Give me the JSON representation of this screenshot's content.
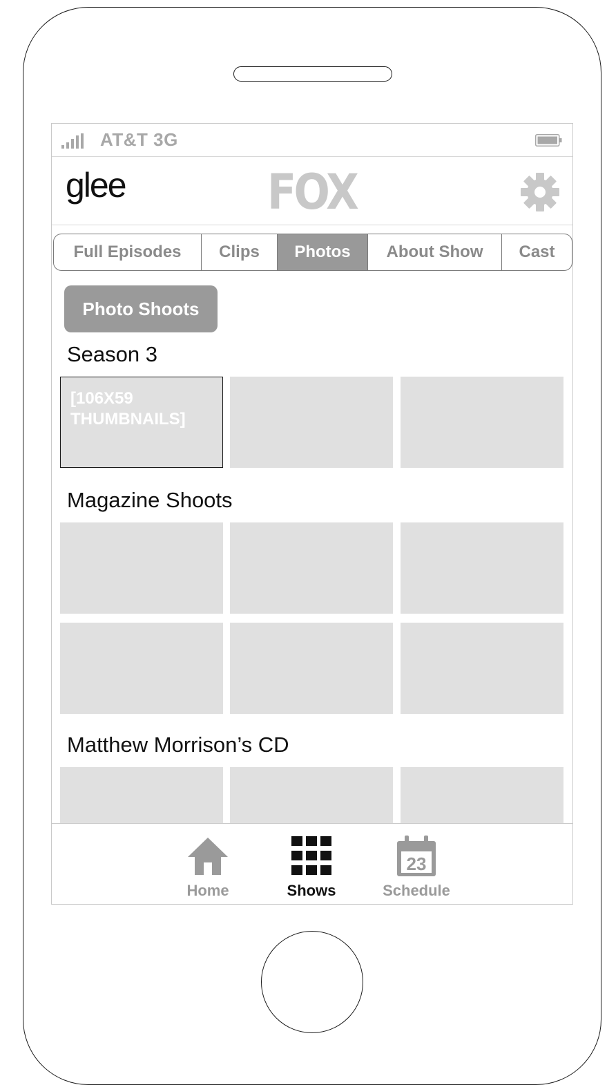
{
  "status_bar": {
    "carrier": "AT&T 3G"
  },
  "header": {
    "show_logo": "glee",
    "network_logo": "FOX"
  },
  "tabs": [
    {
      "label": "Full Episodes",
      "active": false
    },
    {
      "label": "Clips",
      "active": false
    },
    {
      "label": "Photos",
      "active": true
    },
    {
      "label": "About Show",
      "active": false
    },
    {
      "label": "Cast",
      "active": false
    }
  ],
  "filter_button": {
    "label": "Photo Shoots"
  },
  "sections": [
    {
      "title": "Season 3",
      "thumb_note": "[106X59 THUMBNAILS]"
    },
    {
      "title": "Magazine Shoots"
    },
    {
      "title": "Matthew Morrison’s CD"
    }
  ],
  "bottom_tabs": [
    {
      "label": "Home",
      "icon": "home-icon",
      "active": false
    },
    {
      "label": "Shows",
      "icon": "grid-icon",
      "active": true
    },
    {
      "label": "Schedule",
      "icon": "calendar-icon",
      "active": false,
      "icon_text": "23"
    }
  ],
  "colors": {
    "accent_gray": "#999999",
    "thumb_fill": "#e0e0e0",
    "muted_text": "#8a8a8a"
  }
}
